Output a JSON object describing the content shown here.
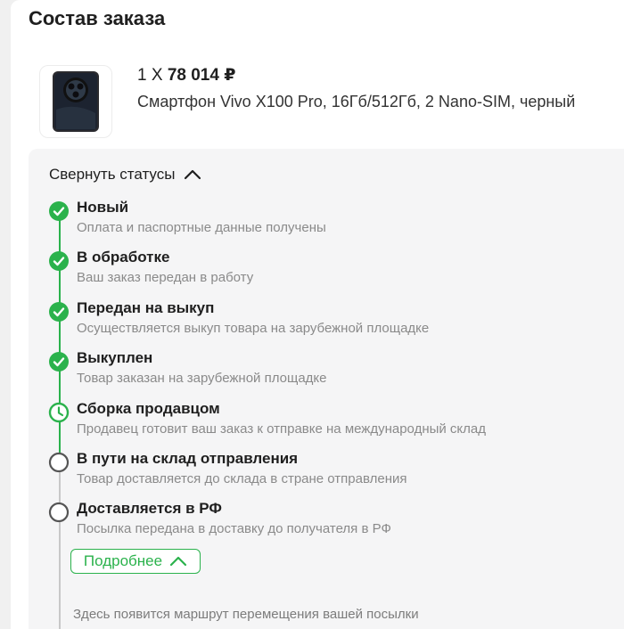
{
  "order": {
    "title": "Состав заказа",
    "item": {
      "qty_label": "1 X",
      "price": "78 014 ₽",
      "name": "Смартфон Vivo X100 Pro, 16Гб/512Гб, 2 Nano-SIM, черный",
      "image": "phone-image"
    }
  },
  "statuses": {
    "collapse_label": "Свернуть статусы",
    "steps": [
      {
        "title": "Новый",
        "desc": "Оплата и паспортные данные получены",
        "state": "done"
      },
      {
        "title": "В обработке",
        "desc": "Ваш заказ передан в работу",
        "state": "done"
      },
      {
        "title": "Передан на выкуп",
        "desc": "Осуществляется выкуп товара на зарубежной площадке",
        "state": "done"
      },
      {
        "title": "Выкуплен",
        "desc": "Товар заказан на зарубежной площадке",
        "state": "done"
      },
      {
        "title": "Сборка продавцом",
        "desc": "Продавец готовит ваш заказ к отправке на международный склад",
        "state": "current"
      },
      {
        "title": "В пути на склад отправления",
        "desc": "Товар доставляется до склада в стране отправления",
        "state": "pending"
      },
      {
        "title": "Доставляется в РФ",
        "desc": "Посылка передана в доставку до получателя в РФ",
        "state": "pending"
      }
    ],
    "more_label": "Подробнее",
    "route_note": "Здесь появится маршрут перемещения вашей посылки"
  },
  "colors": {
    "accent_green": "#2bb24c",
    "pending_gray": "#555555",
    "line_gray": "#c8c8c8"
  }
}
